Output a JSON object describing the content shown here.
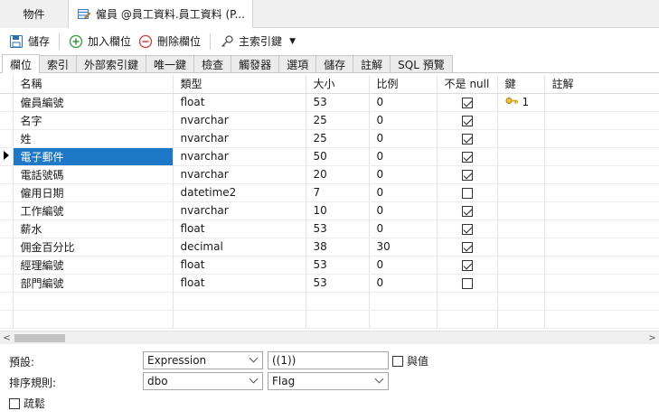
{
  "doc_tabs": {
    "objects": "物件",
    "table_tab": "僱員 @員工資料.員工資料 (P..."
  },
  "toolbar": {
    "save": "儲存",
    "add_field": "加入欄位",
    "delete_field": "刪除欄位",
    "primary_key": "主索引鍵"
  },
  "prop_tabs": [
    "欄位",
    "索引",
    "外部索引鍵",
    "唯一鍵",
    "檢查",
    "觸發器",
    "選項",
    "儲存",
    "註解",
    "SQL 預覽"
  ],
  "grid": {
    "headers": {
      "name": "名稱",
      "type": "類型",
      "size": "大小",
      "scale": "比例",
      "not_null": "不是 null",
      "key": "鍵",
      "comment": "註解"
    },
    "rows": [
      {
        "name": "僱員編號",
        "type": "float",
        "size": "53",
        "scale": "0",
        "not_null": true,
        "key": "1"
      },
      {
        "name": "名字",
        "type": "nvarchar",
        "size": "25",
        "scale": "0",
        "not_null": true,
        "key": ""
      },
      {
        "name": "姓",
        "type": "nvarchar",
        "size": "25",
        "scale": "0",
        "not_null": true,
        "key": ""
      },
      {
        "name": "電子郵件",
        "type": "nvarchar",
        "size": "50",
        "scale": "0",
        "not_null": true,
        "key": ""
      },
      {
        "name": "電話號碼",
        "type": "nvarchar",
        "size": "20",
        "scale": "0",
        "not_null": true,
        "key": ""
      },
      {
        "name": "僱用日期",
        "type": "datetime2",
        "size": "7",
        "scale": "0",
        "not_null": false,
        "key": ""
      },
      {
        "name": "工作編號",
        "type": "nvarchar",
        "size": "10",
        "scale": "0",
        "not_null": true,
        "key": ""
      },
      {
        "name": "薪水",
        "type": "float",
        "size": "53",
        "scale": "0",
        "not_null": true,
        "key": ""
      },
      {
        "name": "佣金百分比",
        "type": "decimal",
        "size": "38",
        "scale": "30",
        "not_null": true,
        "key": ""
      },
      {
        "name": "經理編號",
        "type": "float",
        "size": "53",
        "scale": "0",
        "not_null": true,
        "key": ""
      },
      {
        "name": "部門編號",
        "type": "float",
        "size": "53",
        "scale": "0",
        "not_null": false,
        "key": ""
      }
    ],
    "current_row": 3
  },
  "properties": {
    "default_label": "預設:",
    "default_select": "Expression",
    "default_value": "((1))",
    "as_value_label": "與值",
    "as_value_checked": false,
    "collation_label": "排序規則:",
    "collation_select": "dbo",
    "collation_flag": "Flag",
    "sparse_label": "疏鬆",
    "sparse_checked": false
  },
  "colors": {
    "selection": "#1e78c8",
    "add_icon": "#2e9b3b",
    "delete_icon": "#d43a3a",
    "save_icon": "#2a6fb0",
    "key_icon": "#d9a21b"
  }
}
